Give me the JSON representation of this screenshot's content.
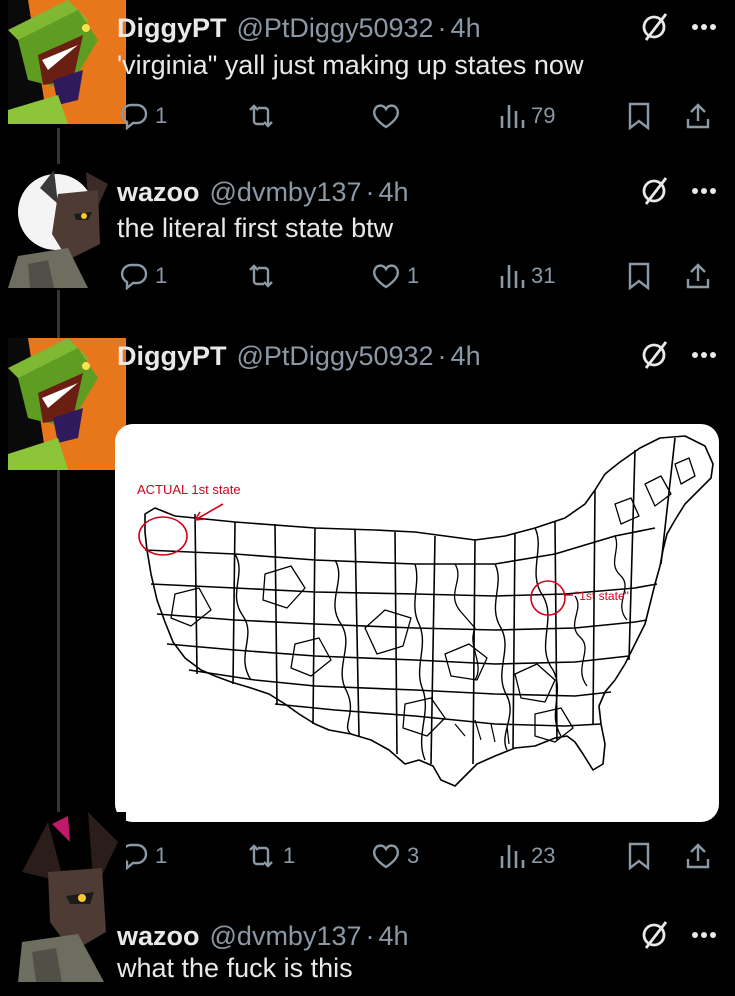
{
  "tweets": [
    {
      "name": "DiggyPT",
      "handle": "@PtDiggy50932",
      "time": "4h",
      "text": "'virginia\" yall just making up states now",
      "replies": "1",
      "reposts": "",
      "likes": "",
      "views": "79"
    },
    {
      "name": "wazoo",
      "handle": "@dvmby137",
      "time": "4h",
      "text": "the literal first state btw",
      "replies": "1",
      "reposts": "",
      "likes": "1",
      "views": "31"
    },
    {
      "name": "DiggyPT",
      "handle": "@PtDiggy50932",
      "time": "4h",
      "text": "",
      "replies": "1",
      "reposts": "1",
      "likes": "3",
      "views": "23",
      "map": {
        "label_actual": "ACTUAL 1st state",
        "label_quote": "\"1st state\""
      }
    },
    {
      "name": "wazoo",
      "handle": "@dvmby137",
      "time": "4h",
      "text": "what the fuck is this"
    }
  ],
  "separator": "·",
  "icons": {
    "grok": "grok-icon",
    "more": "more-icon",
    "reply": "reply-icon",
    "repost": "repost-icon",
    "like": "like-icon",
    "views": "views-icon",
    "bookmark": "bookmark-icon",
    "share": "share-icon"
  },
  "colors": {
    "background": "#000000",
    "text": "#e7e9ea",
    "secondary": "#8b98a5",
    "annotation_red": "#d0021b"
  }
}
